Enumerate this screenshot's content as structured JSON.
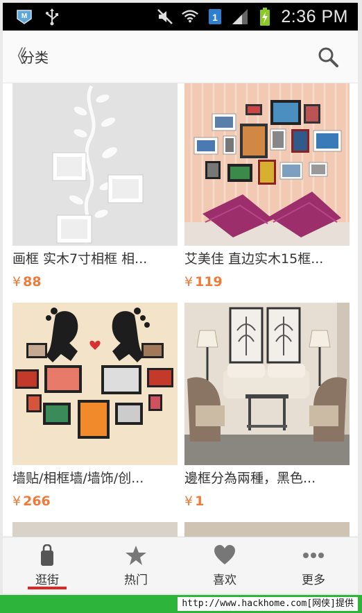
{
  "status_bar": {
    "time": "2:36 PM",
    "sim_badge": "1",
    "icons": [
      "app-badge-icon",
      "usb-icon",
      "mute-icon",
      "wifi-icon",
      "sim-icon",
      "signal-icon",
      "battery-icon"
    ]
  },
  "header": {
    "back_chevron": "《",
    "title": "分类",
    "search_icon": "search-icon"
  },
  "products": [
    {
      "title": "画框 实木7寸相框 相...",
      "currency": "¥",
      "price": "88"
    },
    {
      "title": "艾美佳 直边实木15框...",
      "currency": "¥",
      "price": "119"
    },
    {
      "title": "墙贴/相框墙/墙饰/创...",
      "currency": "¥",
      "price": "266"
    },
    {
      "title": "邊框分為兩種，黑色...",
      "currency": "¥",
      "price": "1"
    }
  ],
  "bottom_nav": {
    "items": [
      {
        "label": "逛街",
        "icon": "bag-icon",
        "active": true
      },
      {
        "label": "热门",
        "icon": "star-icon",
        "active": false
      },
      {
        "label": "喜欢",
        "icon": "heart-icon",
        "active": false
      },
      {
        "label": "更多",
        "icon": "more-dots-icon",
        "active": false
      }
    ]
  },
  "footer": {
    "text": "http://www.hackhome.com[网侠]提供"
  },
  "colors": {
    "price": "#f07a3a",
    "active_tab_indicator": "#e02525",
    "footer_band": "#2db43a"
  }
}
